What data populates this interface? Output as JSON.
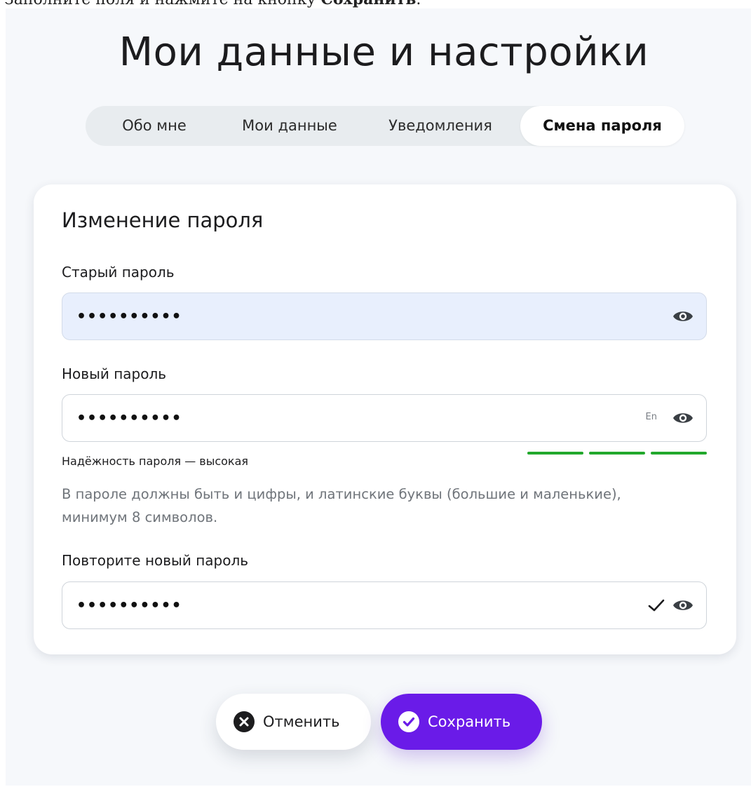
{
  "intro": {
    "prefix": "Заполните поля и нажмите на кнопку ",
    "button_name": "Сохранить",
    "suffix": "."
  },
  "page": {
    "title": "Мои данные и настройки"
  },
  "tabs": [
    {
      "label": "Обо мне",
      "active": false
    },
    {
      "label": "Мои данные",
      "active": false
    },
    {
      "label": "Уведомления",
      "active": false
    },
    {
      "label": "Смена пароля",
      "active": true
    }
  ],
  "form": {
    "title": "Изменение пароля",
    "old_password": {
      "label": "Старый пароль",
      "value": "••••••••••",
      "icon": "eye-icon"
    },
    "new_password": {
      "label": "Новый пароль",
      "value": "••••••••••",
      "layout_indicator": "En",
      "icon": "eye-icon",
      "strength_text": "Надёжность пароля — высокая",
      "strength_level": 3,
      "strength_max": 3,
      "strength_color": "#22a82c"
    },
    "hint": "В пароле должны быть и цифры, и латинские буквы (большие и маленькие), минимум 8 символов.",
    "repeat_password": {
      "label": "Повторите новый пароль",
      "value": "••••••••••",
      "status_icon": "checkmark-icon",
      "icon": "eye-icon"
    }
  },
  "actions": {
    "cancel_label": "Отменить",
    "cancel_icon": "close-circle-icon",
    "save_label": "Сохранить",
    "save_icon": "check-circle-icon",
    "save_color": "#6a1be8"
  },
  "colors": {
    "page_background": "#f6f8fb",
    "tab_track": "#e8ecef",
    "filled_field": "#e8effd",
    "accent": "#6a1be8"
  }
}
